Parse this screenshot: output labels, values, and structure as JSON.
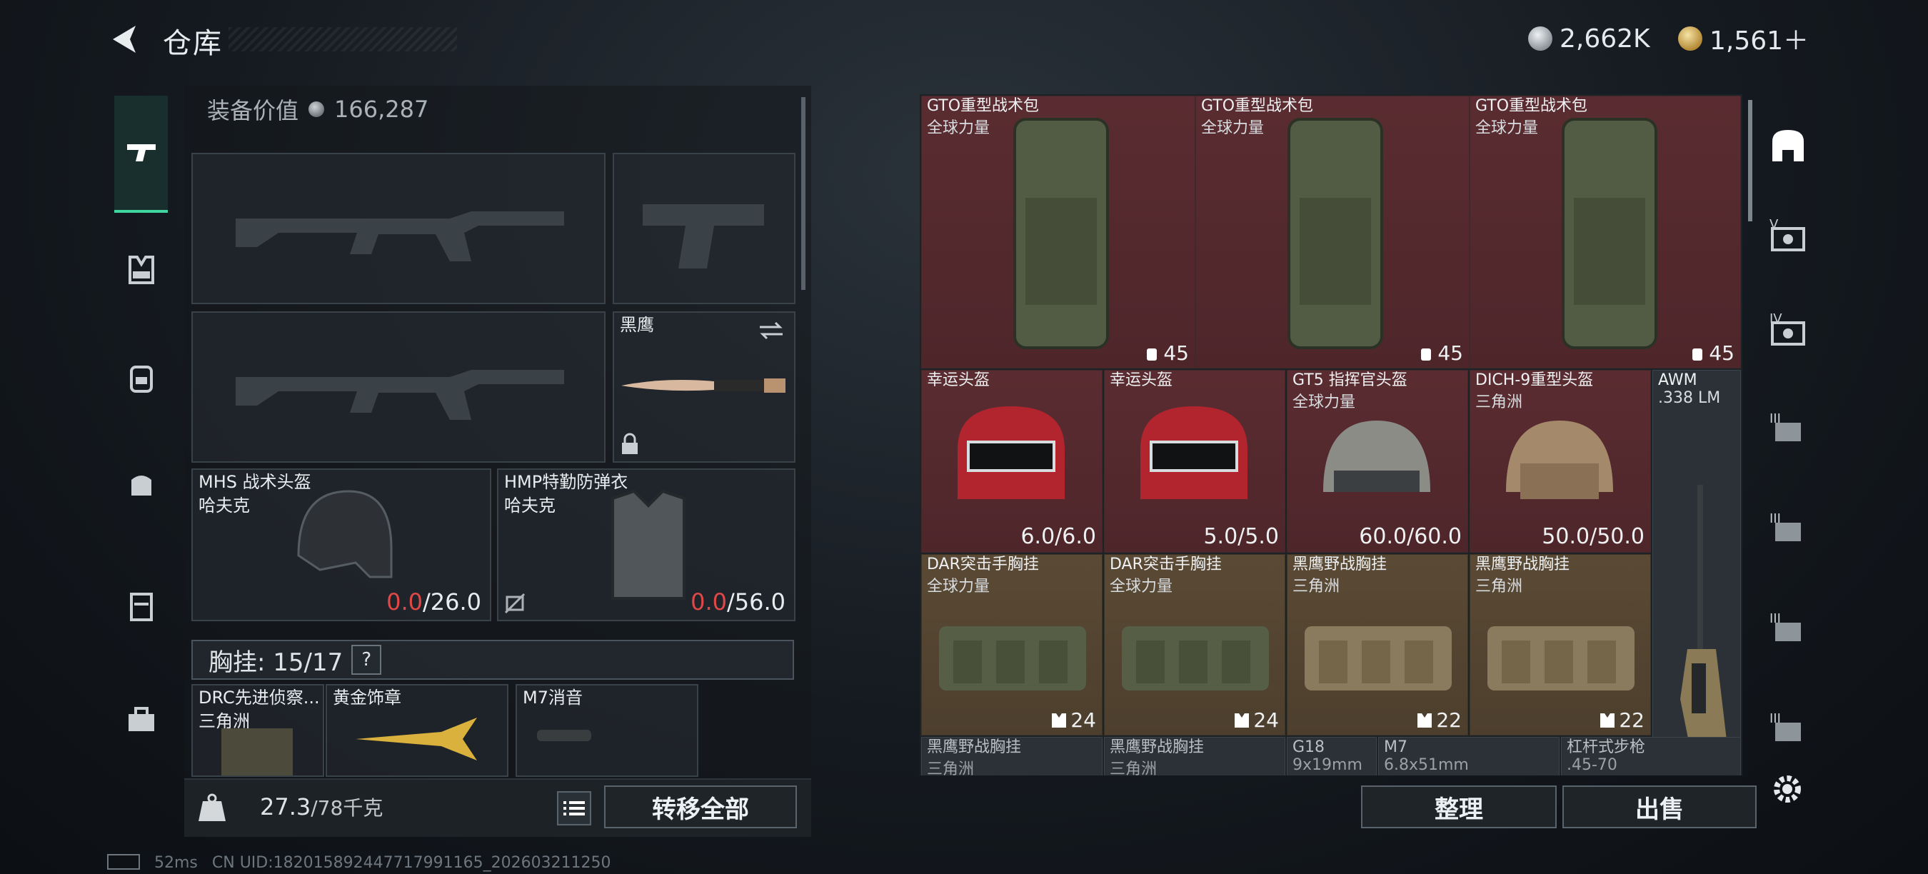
{
  "header": {
    "title": "仓库"
  },
  "currency": {
    "silver": "2,662K",
    "gold": "1,561＋"
  },
  "left": {
    "equip_value_label": "装备价值",
    "equip_value": "166,287",
    "knife_name": "黑鹰",
    "helmet": {
      "name": "MHS 战术头盔",
      "faction": "哈夫克",
      "cur": "0.0",
      "max": "/26.0"
    },
    "armor": {
      "name": "HMP特勤防弹衣",
      "faction": "哈夫克",
      "cur": "0.0",
      "max": "/56.0"
    },
    "rig_label": "胸挂: 15/17",
    "rig_help": "?",
    "rig_items": [
      {
        "name": "DRC先进侦察...",
        "faction": "三角洲"
      },
      {
        "name": "黄金饰章",
        "faction": ""
      },
      {
        "name": "M7消音",
        "faction": ""
      }
    ],
    "weight_current": "27.3",
    "weight_max": "/78千克",
    "transfer_all": "转移全部"
  },
  "stash": {
    "backpacks": [
      {
        "name": "GTO重型战术包",
        "faction": "全球力量",
        "count": "45"
      },
      {
        "name": "GTO重型战术包",
        "faction": "全球力量",
        "count": "45"
      },
      {
        "name": "GTO重型战术包",
        "faction": "全球力量",
        "count": "45"
      }
    ],
    "helmets": [
      {
        "name": "幸运头盔",
        "faction": "",
        "value": "6.0/6.0"
      },
      {
        "name": "幸运头盔",
        "faction": "",
        "value": "5.0/5.0"
      },
      {
        "name": "GT5 指挥官头盔",
        "faction": "全球力量",
        "value": "60.0/60.0"
      },
      {
        "name": "DICH-9重型头盔",
        "faction": "三角洲",
        "value": "50.0/50.0"
      }
    ],
    "awm": {
      "name": "AWM",
      "caliber": ".338 LM"
    },
    "rigs": [
      {
        "name": "DAR突击手胸挂",
        "faction": "全球力量",
        "count": "24"
      },
      {
        "name": "DAR突击手胸挂",
        "faction": "全球力量",
        "count": "24"
      },
      {
        "name": "黑鹰野战胸挂",
        "faction": "三角洲",
        "count": "22"
      },
      {
        "name": "黑鹰野战胸挂",
        "faction": "三角洲",
        "count": "22"
      }
    ],
    "row4": [
      {
        "name": "黑鹰野战胸挂",
        "sub": "三角洲"
      },
      {
        "name": "黑鹰野战胸挂",
        "sub": "三角洲"
      },
      {
        "name": "G18",
        "sub": "9x19mm"
      },
      {
        "name": "M7",
        "sub": "6.8x51mm"
      },
      {
        "name": "杠杆式步枪",
        "sub": ".45-70"
      }
    ],
    "sort_btn": "整理",
    "sell_btn": "出售"
  },
  "right_rail": [
    "V",
    "IV",
    "III",
    "III",
    "III",
    "III"
  ],
  "status": {
    "ping": "52ms",
    "uid": "CN UID:182015892447717991165_202603211250"
  },
  "colors": {
    "accent_green": "#3fd6a0",
    "durability_zero": "#e04848",
    "cell_red": "#55292e",
    "cell_gold": "#54452f"
  }
}
